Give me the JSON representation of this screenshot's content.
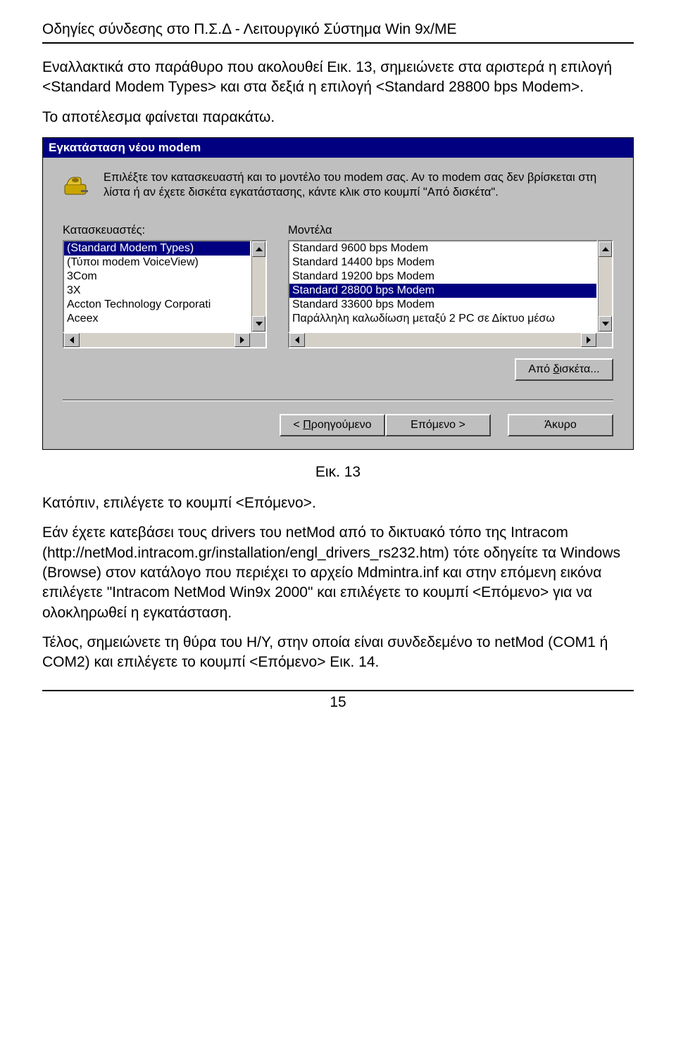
{
  "header": "Οδηγίες σύνδεσης στο Π.Σ.Δ - Λειτουργικό Σύστημα Win 9x/ME",
  "para1": "Εναλλακτικά στο παράθυρο που ακολουθεί Εικ. 13, σημειώνετε στα αριστερά η επιλογή <Standard Modem Types> και στα δεξιά η επιλογή <Standard 28800 bps Modem>.",
  "para2": "Το αποτέλεσμα φαίνεται παρακάτω.",
  "dialog": {
    "title": "Εγκατάσταση νέου modem",
    "instruction": "Επιλέξτε τον κατασκευαστή και το μοντέλο του modem σας. Αν το modem σας δεν βρίσκεται στη λίστα ή αν έχετε δισκέτα εγκατάστασης, κάντε κλικ στο κουμπί \"Από δισκέτα\".",
    "manufacturers_label": "Κατασκευαστές:",
    "models_label": "Μοντέλα",
    "manufacturers": [
      {
        "text": "(Standard Modem Types)",
        "selected": true
      },
      {
        "text": "(Τύποι modem VoiceView)",
        "selected": false
      },
      {
        "text": "3Com",
        "selected": false
      },
      {
        "text": "3X",
        "selected": false
      },
      {
        "text": "Accton Technology Corporati",
        "selected": false
      },
      {
        "text": "Aceex",
        "selected": false
      }
    ],
    "models": [
      {
        "text": "Standard  9600 bps Modem",
        "selected": false
      },
      {
        "text": "Standard 14400 bps Modem",
        "selected": false
      },
      {
        "text": "Standard 19200 bps Modem",
        "selected": false
      },
      {
        "text": "Standard 28800 bps Modem",
        "selected": true
      },
      {
        "text": "Standard 33600 bps Modem",
        "selected": false
      },
      {
        "text": "Παράλληλη καλωδίωση μεταξύ 2 PC σε Δίκτυο μέσω",
        "selected": false
      }
    ],
    "from_disk": "Από δισκέτα...",
    "from_disk_underline": "δ",
    "back": "< Προηγούμενο",
    "back_underline": "Π",
    "next": "Επόμενο >",
    "cancel": "Άκυρο"
  },
  "fig": "Εικ. 13",
  "para3": "Κατόπιν, επιλέγετε το κουμπί <Επόμενο>.",
  "para4": "Εάν έχετε κατεβάσει τους drivers του netMod από το δικτυακό τόπο της Intracom (http://netMod.intracom.gr/installation/engl_drivers_rs232.htm) τότε οδηγείτε τα Windows (Browse) στον κατάλογο που περιέχει το αρχείο Mdmintra.inf και στην επόμενη εικόνα επιλέγετε \"Intracom NetMod Win9x 2000\" και επιλέγετε το κουμπί <Επόμενο> για να ολοκληρωθεί η εγκατάσταση.",
  "para5": "Τέλος, σημειώνετε τη θύρα του Η/Υ, στην οποία είναι συνδεδεμένο το netMod (COM1 ή COM2) και επιλέγετε το κουμπί <Επόμενο> Εικ. 14.",
  "page_number": "15"
}
